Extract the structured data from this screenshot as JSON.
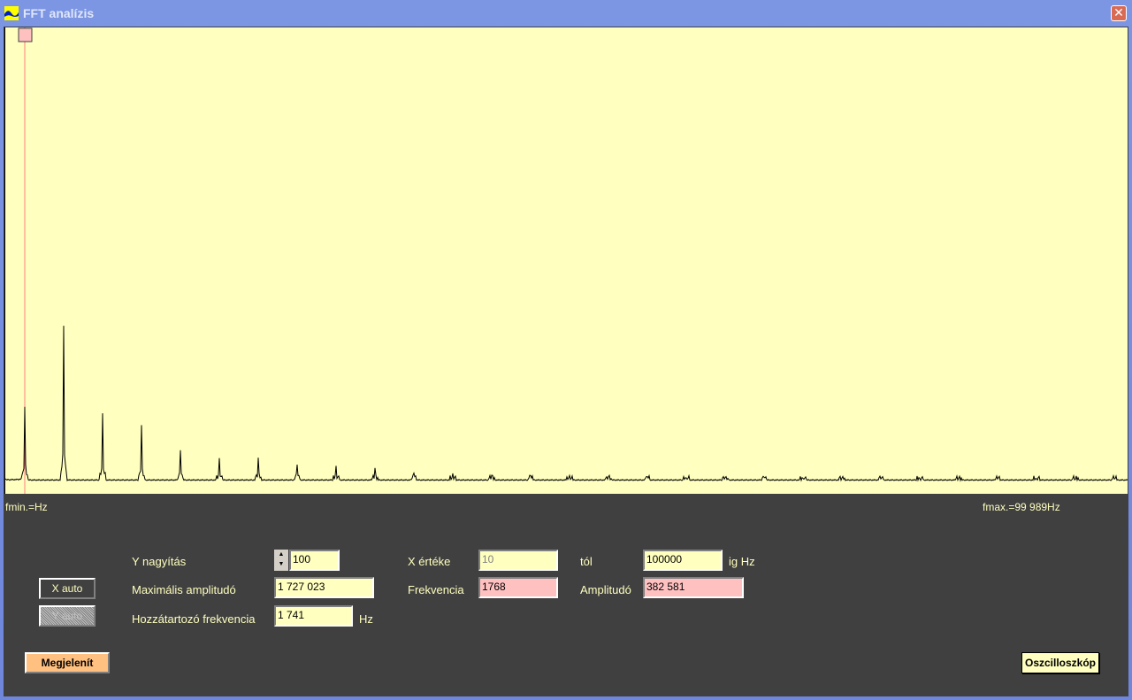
{
  "window": {
    "title": "FFT analízis",
    "close_icon": "close-icon"
  },
  "plot": {
    "background": "#ffffc0",
    "trace_color": "#000000",
    "cursor_color": "#ff8080",
    "fmin_label": "fmin.=Hz",
    "fmax_label": "fmax.=99 989Hz",
    "harmonic_amplitudes": [
      824000,
      1727023,
      754000,
      615000,
      328000,
      248000,
      248000,
      179000,
      159000,
      129000,
      80000,
      70000,
      60000,
      50000,
      45000,
      40000,
      35000,
      30000,
      28000,
      25000,
      22000,
      20000,
      18000,
      16000,
      15000,
      14000,
      13000,
      12000,
      11000
    ]
  },
  "controls": {
    "x_auto": "X auto",
    "y_auto": "Y auto",
    "y_zoom_label": "Y nagyítás",
    "y_zoom_value": "100",
    "max_amp_label": "Maximális amplitudó",
    "max_amp_value": "1 727 023",
    "freq_label": "Hozzátartozó frekvencia",
    "freq_value": "1 741",
    "freq_unit": "Hz",
    "x_value_label": "X értéke",
    "x_from_value": "10",
    "from_label": "tól",
    "x_to_value": "100000",
    "to_label": "ig Hz",
    "cursor_freq_label": "Frekvencia",
    "cursor_freq_value": "1768",
    "cursor_amp_label": "Amplitudó",
    "cursor_amp_value": "382 581",
    "show_button": "Megjelenít",
    "scope_button": "Oszcilloszkóp"
  }
}
